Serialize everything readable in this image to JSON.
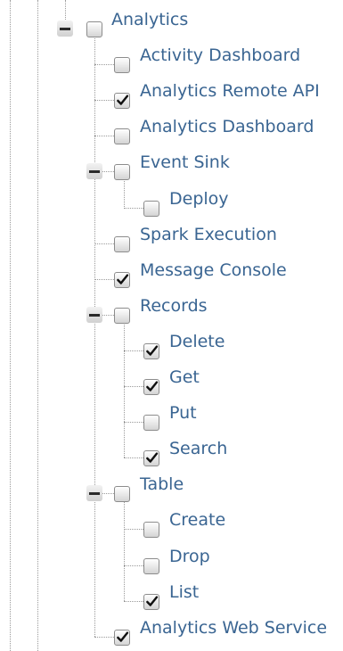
{
  "tree": {
    "nodes": [
      {
        "label": "Analytics",
        "checked": false,
        "depth": 0,
        "toggle": "expanded",
        "last": false
      },
      {
        "label": "Activity Dashboard",
        "checked": false,
        "depth": 1,
        "toggle": null,
        "last": false
      },
      {
        "label": "Analytics Remote API",
        "checked": true,
        "depth": 1,
        "toggle": null,
        "last": false
      },
      {
        "label": "Analytics Dashboard",
        "checked": false,
        "depth": 1,
        "toggle": null,
        "last": false
      },
      {
        "label": "Event Sink",
        "checked": false,
        "depth": 1,
        "toggle": "expanded",
        "last": false
      },
      {
        "label": "Deploy",
        "checked": false,
        "depth": 2,
        "toggle": null,
        "last": true
      },
      {
        "label": "Spark Execution",
        "checked": false,
        "depth": 1,
        "toggle": null,
        "last": false
      },
      {
        "label": "Message Console",
        "checked": true,
        "depth": 1,
        "toggle": null,
        "last": false
      },
      {
        "label": "Records",
        "checked": false,
        "depth": 1,
        "toggle": "expanded",
        "last": false
      },
      {
        "label": "Delete",
        "checked": true,
        "depth": 2,
        "toggle": null,
        "last": false
      },
      {
        "label": "Get",
        "checked": true,
        "depth": 2,
        "toggle": null,
        "last": false
      },
      {
        "label": "Put",
        "checked": false,
        "depth": 2,
        "toggle": null,
        "last": false
      },
      {
        "label": "Search",
        "checked": true,
        "depth": 2,
        "toggle": null,
        "last": true
      },
      {
        "label": "Table",
        "checked": false,
        "depth": 1,
        "toggle": "expanded",
        "last": false
      },
      {
        "label": "Create",
        "checked": false,
        "depth": 2,
        "toggle": null,
        "last": false
      },
      {
        "label": "Drop",
        "checked": false,
        "depth": 2,
        "toggle": null,
        "last": false
      },
      {
        "label": "List",
        "checked": true,
        "depth": 2,
        "toggle": null,
        "last": true
      },
      {
        "label": "Analytics Web Service",
        "checked": true,
        "depth": 1,
        "toggle": null,
        "last": true
      }
    ]
  },
  "colors": {
    "label": "#3a6592",
    "connector": "#9a9a9a"
  },
  "icons": {
    "toggle": "collapse-minus-icon",
    "check": "checkmark-icon"
  }
}
